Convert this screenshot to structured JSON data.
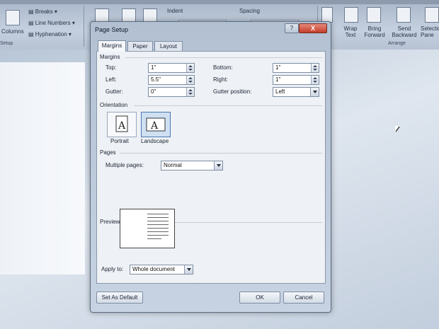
{
  "ribbon": {
    "columns_label": "Columns",
    "breaks_label": "Breaks",
    "line_numbers_label": "Line Numbers",
    "hyphenation_label": "Hyphenation",
    "setup_group": "Setup",
    "indent_label": "Indent",
    "spacing_label": "Spacing",
    "wrap_text_label": "Wrap Text",
    "bring_forward_label": "Bring Forward",
    "send_backward_label": "Send Backward",
    "selection_pane_label": "Selection Pane",
    "arrange_group": "Arrange"
  },
  "dialog": {
    "title": "Page Setup",
    "help": "?",
    "close": "X",
    "tabs": [
      "Margins",
      "Paper",
      "Layout"
    ],
    "active_tab": "Margins",
    "margins": {
      "group_label": "Margins",
      "top_label": "Top:",
      "top_value": "1\"",
      "bottom_label": "Bottom:",
      "bottom_value": "1\"",
      "left_label": "Left:",
      "left_value": "5.5\"",
      "right_label": "Right:",
      "right_value": "1\"",
      "gutter_label": "Gutter:",
      "gutter_value": "0\"",
      "gutter_position_label": "Gutter position:",
      "gutter_position_value": "Left"
    },
    "orientation": {
      "group_label": "Orientation",
      "portrait_label": "Portrait",
      "landscape_label": "Landscape",
      "selected": "Landscape"
    },
    "pages": {
      "group_label": "Pages",
      "multiple_pages_label": "Multiple pages:",
      "multiple_pages_value": "Normal"
    },
    "preview": {
      "group_label": "Preview",
      "apply_to_label": "Apply to:",
      "apply_to_value": "Whole document"
    },
    "buttons": {
      "set_default": "Set As Default",
      "ok": "OK",
      "cancel": "Cancel"
    }
  }
}
